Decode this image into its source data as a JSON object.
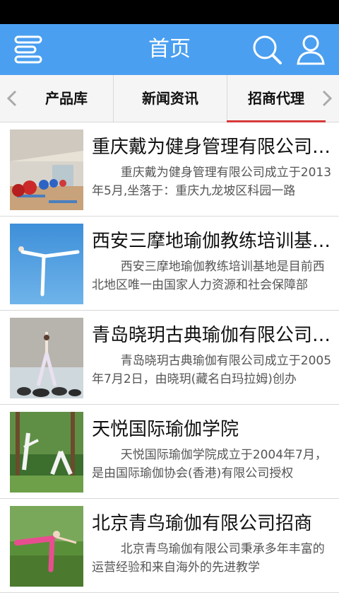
{
  "header": {
    "title": "首页"
  },
  "tabs": [
    {
      "label": "产品库"
    },
    {
      "label": "新闻资讯"
    },
    {
      "label": "招商代理"
    }
  ],
  "items": [
    {
      "title": "重庆戴为健身管理有限公司招商",
      "desc": "重庆戴为健身管理有限公司成立于2013年5月,坐落于：重庆九龙坡区科园一路"
    },
    {
      "title": "西安三摩地瑜伽教练培训基地招商",
      "desc": "西安三摩地瑜伽教练培训基地是目前西北地区唯一由国家人力资源和社会保障部"
    },
    {
      "title": "青岛晓玥古典瑜伽有限公司招商",
      "desc": "青岛晓玥古典瑜伽有限公司成立于2005年7月2日，由晓玥(藏名白玛拉姆)创办"
    },
    {
      "title": "天悦国际瑜伽学院",
      "desc": "天悦国际瑜伽学院成立于2004年7月，是由国际瑜伽协会(香港)有限公司授权"
    },
    {
      "title": "北京青鸟瑜伽有限公司招商",
      "desc": "北京青鸟瑜伽有限公司秉承多年丰富的运营经验和来自海外的先进教学"
    }
  ],
  "icons": {
    "menu": "menu-icon",
    "search": "search-icon",
    "user": "user-icon",
    "left": "chevron-left-icon",
    "right": "chevron-right-icon"
  },
  "colors": {
    "header": "#4a9ff0",
    "active_tab": "#d63a3a"
  }
}
